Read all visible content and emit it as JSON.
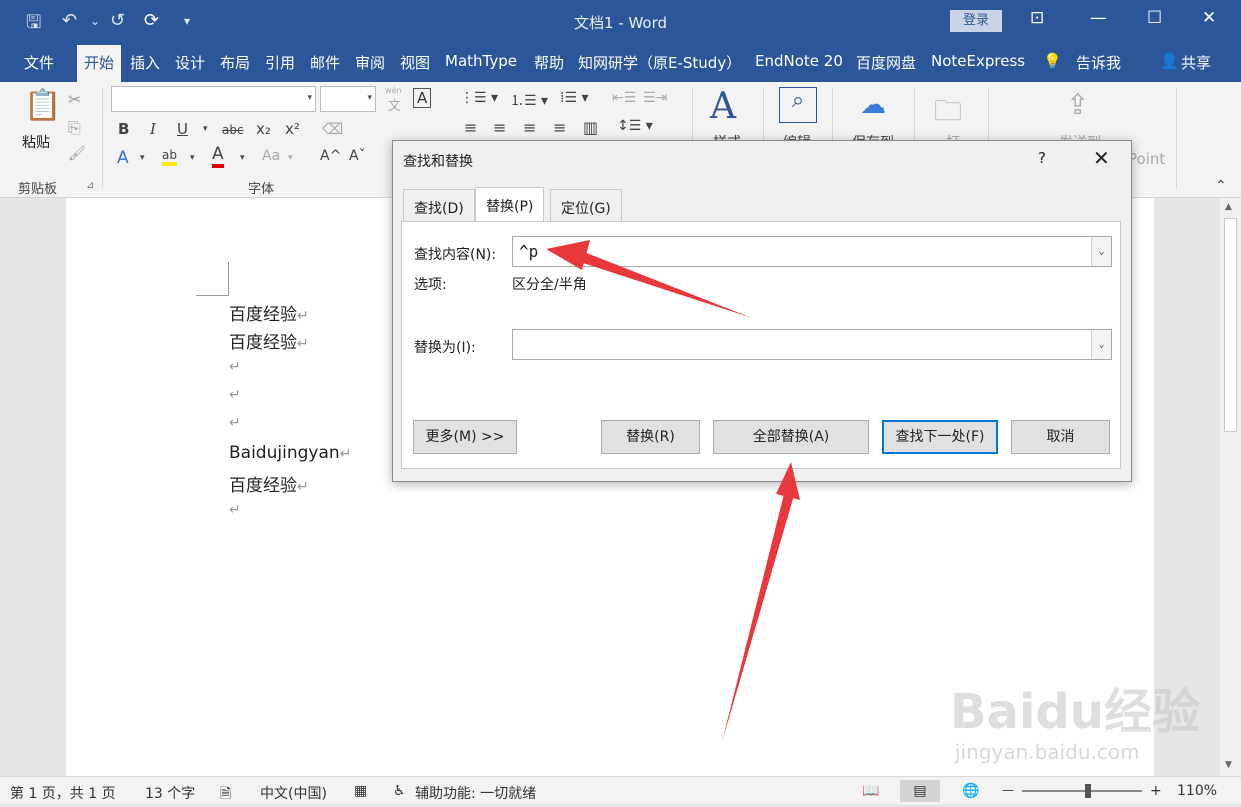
{
  "titlebar": {
    "title": "文档1  -  Word",
    "login": "登录",
    "quick_access": [
      "save-icon",
      "undo-icon",
      "redo-icon",
      "sync-icon",
      "customize-icon"
    ],
    "save_glyph": "🖫",
    "undo_glyph": "↶",
    "undo_dd": "⌄",
    "redo_glyph": "↺",
    "sync_glyph": "⟳",
    "customize_glyph": "▾",
    "ribbon_opts_glyph": "⊡",
    "minimize_glyph": "—",
    "maximize_glyph": "☐",
    "close_glyph": "✕"
  },
  "menu": {
    "tabs": [
      "文件",
      "开始",
      "插入",
      "设计",
      "布局",
      "引用",
      "邮件",
      "审阅",
      "视图",
      "MathType",
      "帮助",
      "知网研学（原E-Study）",
      "EndNote 20",
      "百度网盘",
      "NoteExpress",
      "告诉我",
      "共享"
    ],
    "active": "开始",
    "bulb_glyph": "💡",
    "share_glyph": "👤"
  },
  "ribbon": {
    "paste": "粘贴",
    "clipboard": "剪贴板",
    "font_group": "字体",
    "styles": "样式",
    "edit": "编辑",
    "save_to": "保存到",
    "open": "打",
    "send_to": "发送到",
    "point": "Point",
    "paste_glyph": "📋",
    "cut_glyph": "✂",
    "copy_glyph": "⎘",
    "brush_glyph": "🖌",
    "expand_glyph": "⊿",
    "wen": "wén",
    "wen_char": "文",
    "a_box": "A",
    "B": "B",
    "I": "I",
    "U": "U",
    "U_dd": "▾",
    "abc": "abc",
    "x2_sub": "x₂",
    "x2_sup": "x²",
    "eraser_glyph": "⌫",
    "text_effect": "A",
    "text_effect_dd": "▾",
    "highlight": "ab",
    "highlight_dd": "▾",
    "font_color": "A",
    "font_color_dd": "▾",
    "aa": "Aa",
    "aa_dd": "▾",
    "grow": "A^",
    "shrink": "Aˇ",
    "bullets": "⋮☰ ▾",
    "numbering": "⒈☰ ▾",
    "multilevel": "⁞☰ ▾",
    "decrease_indent": "⇤☰",
    "increase_indent": "☰⇥",
    "align_left": "≡",
    "align_center": "≡",
    "align_right": "≡",
    "justify": "≡",
    "distributed": "▥",
    "line_spacing": "↕☰ ▾",
    "styles_glyph": "A",
    "search_glyph": "⌕",
    "cloud_glyph": "☁",
    "folder_glyph": "🗀",
    "send_glyph": "⇪",
    "collapse_glyph": "⌃",
    "font_dd": "▾",
    "size_dd": "▾"
  },
  "document": {
    "lines": [
      "百度经验",
      "百度经验",
      "",
      "",
      "",
      "Baidujingyan",
      "百度经验",
      ""
    ],
    "para_mark": "↵"
  },
  "dialog": {
    "title": "查找和替换",
    "help": "?",
    "close_glyph": "✕",
    "tabs": [
      "查找(D)",
      "替换(P)",
      "定位(G)"
    ],
    "active_tab": "替换(P)",
    "find_label": "查找内容(N):",
    "find_value": "^p",
    "options_label": "选项:",
    "options_value": "区分全/半角",
    "replace_label": "替换为(I):",
    "replace_value": "",
    "dropdown_glyph": "⌄",
    "buttons": {
      "more": "更多(M) >>",
      "replace": "替换(R)",
      "replace_all": "全部替换(A)",
      "find_next": "查找下一处(F)",
      "cancel": "取消"
    }
  },
  "status": {
    "page": "第 1 页，共 1 页",
    "words": "13 个字",
    "proof_glyph": "🗎",
    "language": "中文(中国)",
    "macro_glyph": "▦",
    "accessibility": "辅助功能: 一切就绪",
    "access_glyph": "♿",
    "read_glyph": "📖",
    "print_glyph": "▤",
    "web_glyph": "🌐",
    "zoom_minus": "—",
    "zoom_plus": "+",
    "zoom_level": 0.55,
    "zoom": "110%"
  },
  "scrollbar": {
    "up": "▲",
    "down": "▼"
  },
  "watermark": {
    "brand": "Baidu经验",
    "url": "jingyan.baidu.com"
  },
  "colors": {
    "brand_blue": "#2b579a",
    "arrow_red": "#e8383b",
    "dialog_default_border": "#0078d7"
  }
}
